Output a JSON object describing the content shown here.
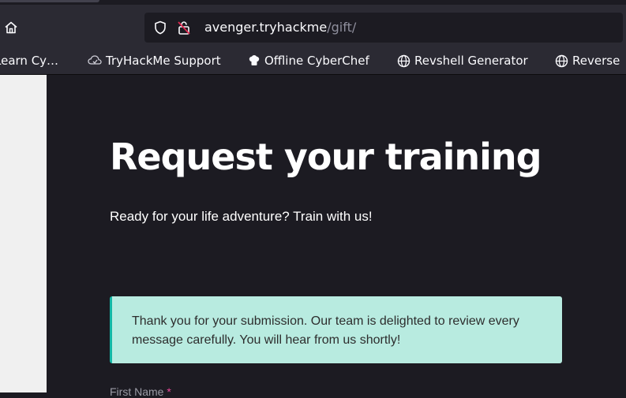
{
  "browser": {
    "url_host": "avenger.tryhackme",
    "url_path": "/gift/",
    "bookmarks": [
      {
        "label": "Learn Cy…",
        "icon": "tryhackme-icon"
      },
      {
        "label": "TryHackMe Support",
        "icon": "support-cloud-icon"
      },
      {
        "label": "Offline CyberChef",
        "icon": "chef-hat-icon"
      },
      {
        "label": "Revshell Generator",
        "icon": "globe-icon"
      },
      {
        "label": "Reverse",
        "icon": "globe-icon"
      }
    ]
  },
  "page": {
    "title": "Request your training",
    "subtitle": "Ready for your life adventure? Train with us!",
    "alert": {
      "message": "Thank you for your submission. Our team is delighted to review every message carefully. You will hear from us shortly!",
      "background": "#b8ebe0",
      "accent": "#14b8a6"
    },
    "form": {
      "first_name_label": "First Name",
      "required_marker": "*"
    }
  }
}
